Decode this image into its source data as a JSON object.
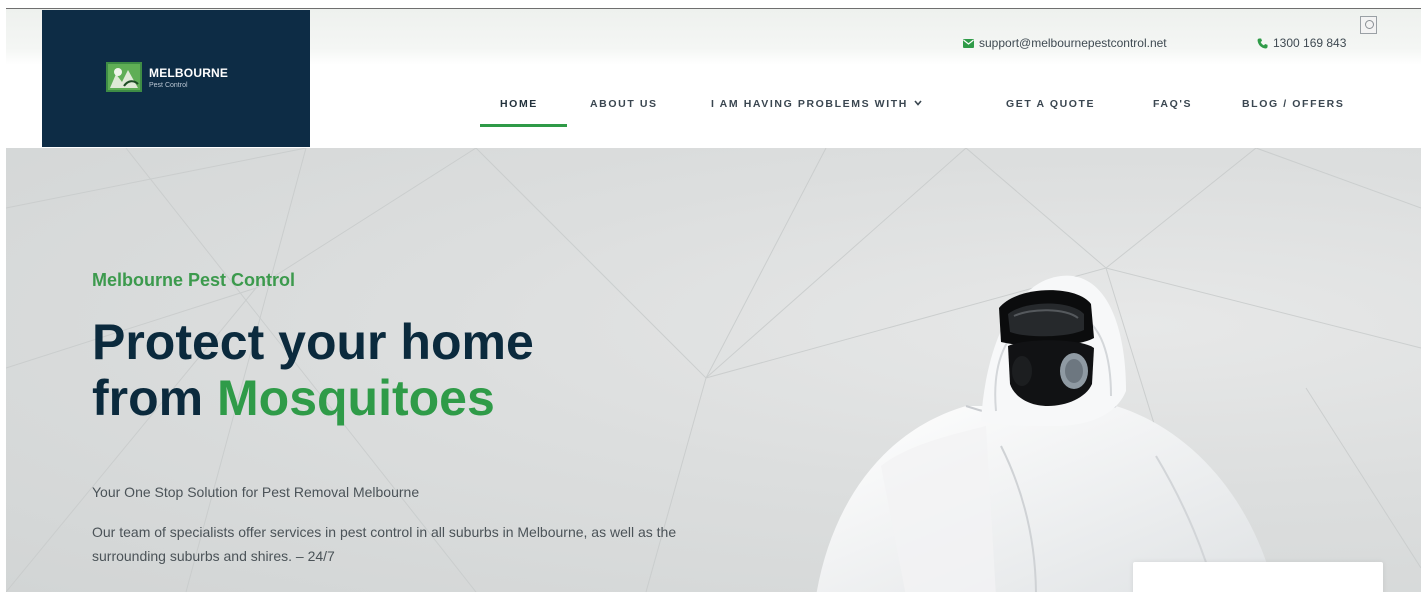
{
  "header": {
    "logo": {
      "title": "MELBOURNE",
      "subtitle": "Pest Control"
    },
    "contact": {
      "email": "support@melbournepestcontrol.net",
      "phone": "1300 169 843"
    },
    "nav": {
      "home": "HOME",
      "about": "ABOUT US",
      "problems": "I AM HAVING PROBLEMS WITH",
      "quote": "GET A QUOTE",
      "faq": "FAQ'S",
      "blog": "BLOG / OFFERS"
    },
    "active_nav": "HOME"
  },
  "hero": {
    "kicker": "Melbourne Pest Control",
    "headline_line1": "Protect your home",
    "headline_from": "from ",
    "headline_accent": "Mosquitoes",
    "tagline": "Your One Stop Solution for Pest Removal Melbourne",
    "body": "Our team of specialists offer services in pest control in all suburbs in Melbourne, as well as the surrounding suburbs and shires. – 24/7"
  },
  "icons": {
    "email": "envelope-icon",
    "phone": "phone-icon",
    "dropdown": "chevron-down-icon",
    "user": "user-icon"
  },
  "colors": {
    "brand_navy": "#0d2c45",
    "brand_green": "#2f9b48",
    "nav_text": "#3a4650"
  }
}
